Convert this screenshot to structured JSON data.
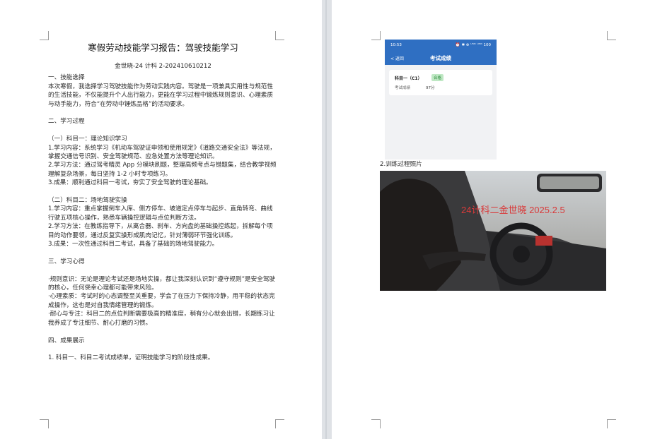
{
  "page1": {
    "title": "寒假劳动技能学习报告：驾驶技能学习",
    "author": "金世晓-24 计科 2-202410610212",
    "lines": [
      "一、技能选择",
      "本次寒假，我选择学习驾驶技能作为劳动实践内容。驾驶是一项兼具实用性与规范性的生活技能，不仅能提升个人出行能力，更能在学习过程中锻炼规则意识、心理素质与动手能力，符合“在劳动中锤炼品格”的活动要求。",
      "",
      "二、学习过程",
      "",
      "（一）科目一：理论知识学习",
      "1.学习内容：系统学习《机动车驾驶证申领和使用规定》《道路交通安全法》等法规，掌握交通信号识别、安全驾驶规范、应急处置方法等理论知识。",
      "2.学习方法：通过驾考精灵 App 分模块刷题，整理高频考点与错题集，结合教学视频理解复杂场景，每日坚持 1-2 小时专项练习。",
      "3.成果：顺利通过科目一考试，夯实了安全驾驶的理论基础。",
      "",
      "（二）科目二：场地驾驶实操",
      "1.学习内容：重点掌握倒车入库、侧方停车、坡道定点停车与起步、直角转弯、曲线行驶五项核心操作，熟悉车辆操控逻辑与点位判断方法。",
      "2.学习方法：在教练指导下，从离合器、刹车、方向盘的基础操控练起，拆解每个项目的动作要领，通过反复实操形成肌肉记忆，针对薄弱环节强化训练。",
      "3.成果：一次性通过科目二考试，具备了基础的场地驾驶能力。",
      "",
      "三、学习心得",
      "",
      "·规则意识：无论是理论考试还是场地实操，都让我深刻认识到“遵守规则”是安全驾驶的核心，任何侥幸心理都可能带来风险。",
      "·心理素质：考试时的心态调整至关重要，学会了在压力下保持冷静，用平稳的状态完成操作，这也是对自我情绪管理的锻炼。",
      "·耐心与专注：科目二的点位判断需要极高的精准度，稍有分心就会出错，长期练习让我养成了专注细节、耐心打磨的习惯。",
      "",
      "四、成果展示",
      "",
      "1. 科目一、科目二考试成绩单，证明技能学习的阶段性成果。"
    ]
  },
  "page2": {
    "phone": {
      "time": "10:53",
      "status_icons": "⏰ ✱ ⊕ ᵁ⁵ᴳ ᵁ⁵ᴳ 100",
      "back_label": "< 返回",
      "nav_title": "考试成绩",
      "subject": "科目一（C1）",
      "badge": "合格",
      "score_label": "考试成绩",
      "score_value": "97分"
    },
    "caption": "2.训练过程照片",
    "photo_stamp": "24计科二金世晓 2025.2.5"
  },
  "colors": {
    "nav_blue": "#2f6fc2",
    "badge_green": "#2a8a3a",
    "stamp_red": "#d93a3a"
  }
}
